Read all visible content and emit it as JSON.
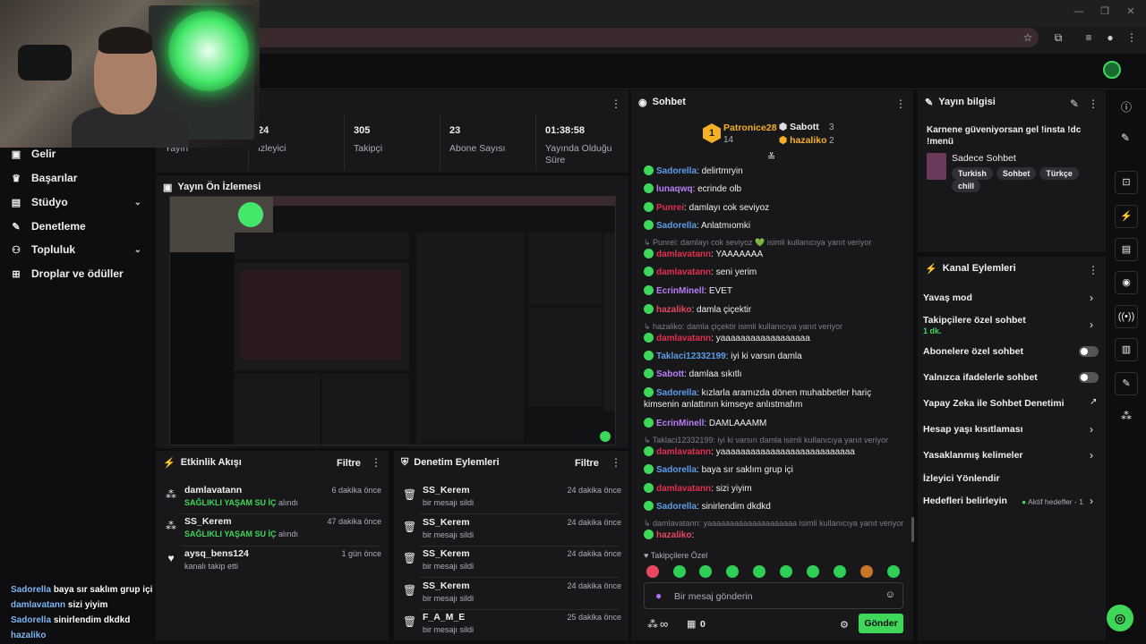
{
  "browser": {
    "icons": [
      "star-icon",
      "extension-icon",
      "media-icon",
      "profile-icon",
      "menu-icon"
    ]
  },
  "sidebar": {
    "items": [
      {
        "label": "Gelir",
        "icon": "revenue-icon"
      },
      {
        "label": "Başarılar",
        "icon": "trophy-icon"
      },
      {
        "label": "Stüdyo",
        "icon": "studio-icon"
      },
      {
        "label": "Denetleme",
        "icon": "wrench-icon"
      },
      {
        "label": "Topluluk",
        "icon": "community-icon"
      },
      {
        "label": "Droplar ve ödüller",
        "icon": "drops-icon"
      }
    ]
  },
  "stats": {
    "items": [
      {
        "value": "",
        "label": "Yayın"
      },
      {
        "value": "24",
        "label": "İzleyici"
      },
      {
        "value": "305",
        "label": "Takipçi"
      },
      {
        "value": "23",
        "label": "Abone Sayısı"
      },
      {
        "value": "01:38:58",
        "label": "Yayında Olduğu Süre"
      }
    ]
  },
  "preview": {
    "title": "Yayın Ön İzlemesi"
  },
  "activity": {
    "title": "Etkinlik Akışı",
    "filter": "Filtre",
    "items": [
      {
        "name": "damlavatann",
        "detail_highlight": "SAĞLIKLI YAŞAM SU İÇ",
        "detail": "alındı",
        "time": "6 dakika önce"
      },
      {
        "name": "SS_Kerem",
        "detail_highlight": "SAĞLIKLI YAŞAM SU İÇ",
        "detail": "alındı",
        "time": "47 dakika önce"
      },
      {
        "name": "aysq_bens124",
        "detail_highlight": "",
        "detail": "kanalı takip etti",
        "time": "1 gün önce"
      }
    ]
  },
  "modlog": {
    "title": "Denetim Eylemleri",
    "filter": "Filtre",
    "items": [
      {
        "name": "SS_Kerem",
        "detail": "bir mesajı sildi",
        "time": "24 dakika önce"
      },
      {
        "name": "SS_Kerem",
        "detail": "bir mesajı sildi",
        "time": "24 dakika önce"
      },
      {
        "name": "SS_Kerem",
        "detail": "bir mesajı sildi",
        "time": "24 dakika önce"
      },
      {
        "name": "SS_Kerem",
        "detail": "bir mesajı sildi",
        "time": "24 dakika önce"
      },
      {
        "name": "F_A_M_E",
        "detail": "bir mesajı sildi",
        "time": "25 dakika önce"
      }
    ]
  },
  "chat": {
    "title": "Sohbet",
    "leaderboard": {
      "first": {
        "rank": "1",
        "name": "Patronice28",
        "count": "14"
      },
      "second": {
        "name": "Sabott",
        "count": "3"
      },
      "third": {
        "name": "hazaliko",
        "count": "2"
      }
    },
    "messages": [
      {
        "user": "Sadorella",
        "color": "#5c9ee8",
        "text": ": delirtmryin"
      },
      {
        "user": "lunaqwq",
        "color": "#b87ff5",
        "text": ": ecrinde olb"
      },
      {
        "user": "Punrei",
        "color": "#e0304d",
        "text": ": damlayı cok seviyoz"
      },
      {
        "user": "Sadorella",
        "color": "#5c9ee8",
        "text": ": Anlatmıomki"
      },
      {
        "reply": "Punrei: damlayı cok seviyoz 💚 isimli kullanıcıya yanıt veriyor"
      },
      {
        "user": "damlavatann",
        "color": "#e0304d",
        "text": ": YAAAAAAA"
      },
      {
        "user": "damlavatann",
        "color": "#e0304d",
        "text": ": seni yerim"
      },
      {
        "user": "EcrinMinell",
        "color": "#b87ff5",
        "text": ": EVET"
      },
      {
        "user": "hazaliko",
        "color": "#e8475e",
        "text": ": damla çiçektir"
      },
      {
        "reply": "hazaliko: damla çiçektir isimli kullanıcıya yanıt veriyor"
      },
      {
        "user": "damlavatann",
        "color": "#e0304d",
        "text": ": yaaaaaaaaaaaaaaaaaa"
      },
      {
        "user": "Taklaci12332199",
        "color": "#5c9ee8",
        "text": ": iyi ki varsın damla"
      },
      {
        "user": "Sabott",
        "color": "#b87ff5",
        "text": ": damlaa sıkıtlı"
      },
      {
        "user": "Sadorella",
        "color": "#5c9ee8",
        "text": ": kızlarla aramızda dönen muhabbetler hariç kimsenin anlattının kimseye anlıstmafım"
      },
      {
        "user": "EcrinMinell",
        "color": "#b87ff5",
        "text": ": DAMLAAAMM"
      },
      {
        "reply": "Taklaci12332199: iyi ki varsın damla isimli kullanıcıya yanıt veriyor"
      },
      {
        "user": "damlavatann",
        "color": "#e0304d",
        "text": ": yaaaaaaaaaaaaaaaaaaaaaaaaaaa"
      },
      {
        "user": "Sadorella",
        "color": "#5c9ee8",
        "text": ": baya sır saklım grup içi"
      },
      {
        "user": "damlavatann",
        "color": "#e0304d",
        "text": ": sizi yiyim"
      },
      {
        "user": "Sadorella",
        "color": "#5c9ee8",
        "text": ": sinirlendim dkdkd"
      },
      {
        "reply": "damlavatann: yaaaaaaaaaaaaaaaaaaaa isimli kullanıcıya yanıt veriyor"
      },
      {
        "user": "hazaliko",
        "color": "#e8475e",
        "text": ":"
      }
    ],
    "followers_only": "Takipçilere Özel",
    "input_placeholder": "Bir mesaj gönderin",
    "points": "0",
    "send_label": "Gönder"
  },
  "stream_info": {
    "title": "Yayın bilgisi",
    "stream_title": "Karnene güveniyorsan gel !insta !dc !menü",
    "category": "Sadece Sohbet",
    "tags": [
      "Turkish",
      "Sohbet",
      "Türkçe",
      "chill"
    ]
  },
  "channel_actions": {
    "title": "Kanal Eylemleri",
    "items": [
      {
        "label": "Yavaş mod",
        "control": "chevron"
      },
      {
        "label": "Takipçilere özel sohbet",
        "sub": "1 dk.",
        "control": "chevron"
      },
      {
        "label": "Abonelere özel sohbet",
        "control": "toggle"
      },
      {
        "label": "Yalnızca ifadelerle sohbet",
        "control": "toggle"
      },
      {
        "label": "Yapay Zeka ile Sohbet Denetimi",
        "control": "external"
      },
      {
        "label": "Hesap yaşı kısıtlaması",
        "control": "chevron"
      },
      {
        "label": "Yasaklanmış kelimeler",
        "control": "chevron"
      },
      {
        "label": "İzleyici Yönlendir",
        "control": "none"
      },
      {
        "label": "Hedefleri belirleyin",
        "extra": "Aktif hedefler - 1",
        "control": "chevron"
      }
    ]
  },
  "overlay_chat": [
    {
      "user": "Sadorella",
      "text": "baya sır saklım grup içi"
    },
    {
      "user": "damlavatann",
      "text": "sizi yiyim"
    },
    {
      "user": "Sadorella",
      "text": "sinirlendim dkdkd"
    },
    {
      "user": "hazaliko",
      "text": ""
    }
  ],
  "colors": {
    "accent": "#3fd75a",
    "bg": "#0e0e10",
    "panel": "#18181b"
  }
}
